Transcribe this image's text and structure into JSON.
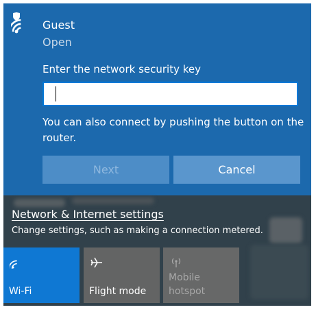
{
  "network": {
    "name": "Guest",
    "status": "Open",
    "key_prompt": "Enter the network security key",
    "key_value": "",
    "wps_hint": "You can also connect by pushing the button on the router.",
    "next_label": "Next",
    "cancel_label": "Cancel"
  },
  "settings": {
    "link_label": "Network & Internet settings",
    "description": "Change settings, such as making a connection metered."
  },
  "quick_actions": [
    {
      "label": "Wi-Fi",
      "icon": "wifi-icon",
      "state": "on"
    },
    {
      "label": "Flight mode",
      "icon": "airplane-icon",
      "state": "off"
    },
    {
      "label": "Mobile hotspot",
      "icon": "hotspot-icon",
      "state": "disabled"
    }
  ],
  "colors": {
    "panel_blue": "#1c69ad",
    "accent": "#0078d7",
    "tile_on": "#0f78d3",
    "tile_off": "#636464"
  }
}
